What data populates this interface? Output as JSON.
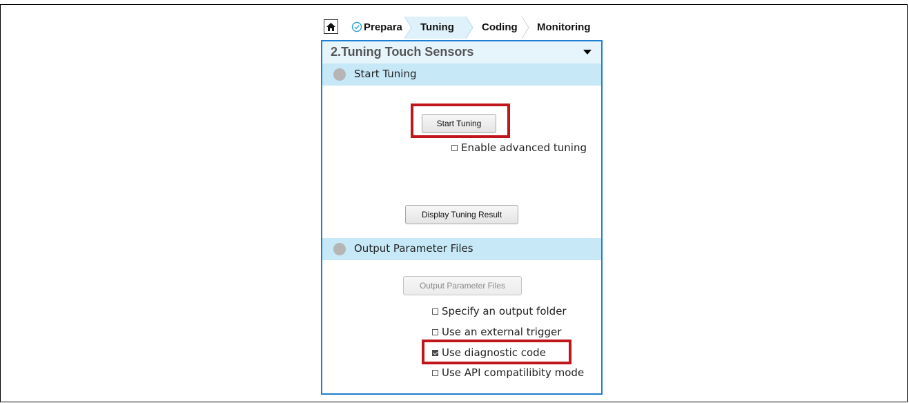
{
  "breadcrumb": {
    "items": [
      {
        "label": "Prepara",
        "state": "done"
      },
      {
        "label": "Tuning",
        "state": "active"
      },
      {
        "label": "Coding",
        "state": "pending"
      },
      {
        "label": "Monitoring",
        "state": "pending"
      }
    ],
    "home_icon": "home-icon",
    "done_icon": "check-circle-icon"
  },
  "panel": {
    "title": "2.Tuning Touch Sensors",
    "sections": [
      {
        "label": "Start Tuning"
      },
      {
        "label": "Output Parameter Files"
      }
    ]
  },
  "tuning": {
    "start_button": "Start Tuning",
    "advanced_checkbox": {
      "label": "Enable advanced tuning",
      "checked": false
    },
    "display_button": "Display Tuning Result"
  },
  "output": {
    "output_button": "Output Parameter Files",
    "options": [
      {
        "label": "Specify an output folder",
        "checked": false
      },
      {
        "label": "Use an external trigger",
        "checked": false
      },
      {
        "label": "Use diagnostic code",
        "checked": true
      },
      {
        "label": "Use API compatilibity mode",
        "checked": false
      }
    ]
  },
  "colors": {
    "accent_border": "#1d7fd2",
    "section_bg": "#c6e8f7",
    "header_bg": "#e6f4fc",
    "highlight": "#c0151b",
    "done_check": "#2a9fd6"
  }
}
